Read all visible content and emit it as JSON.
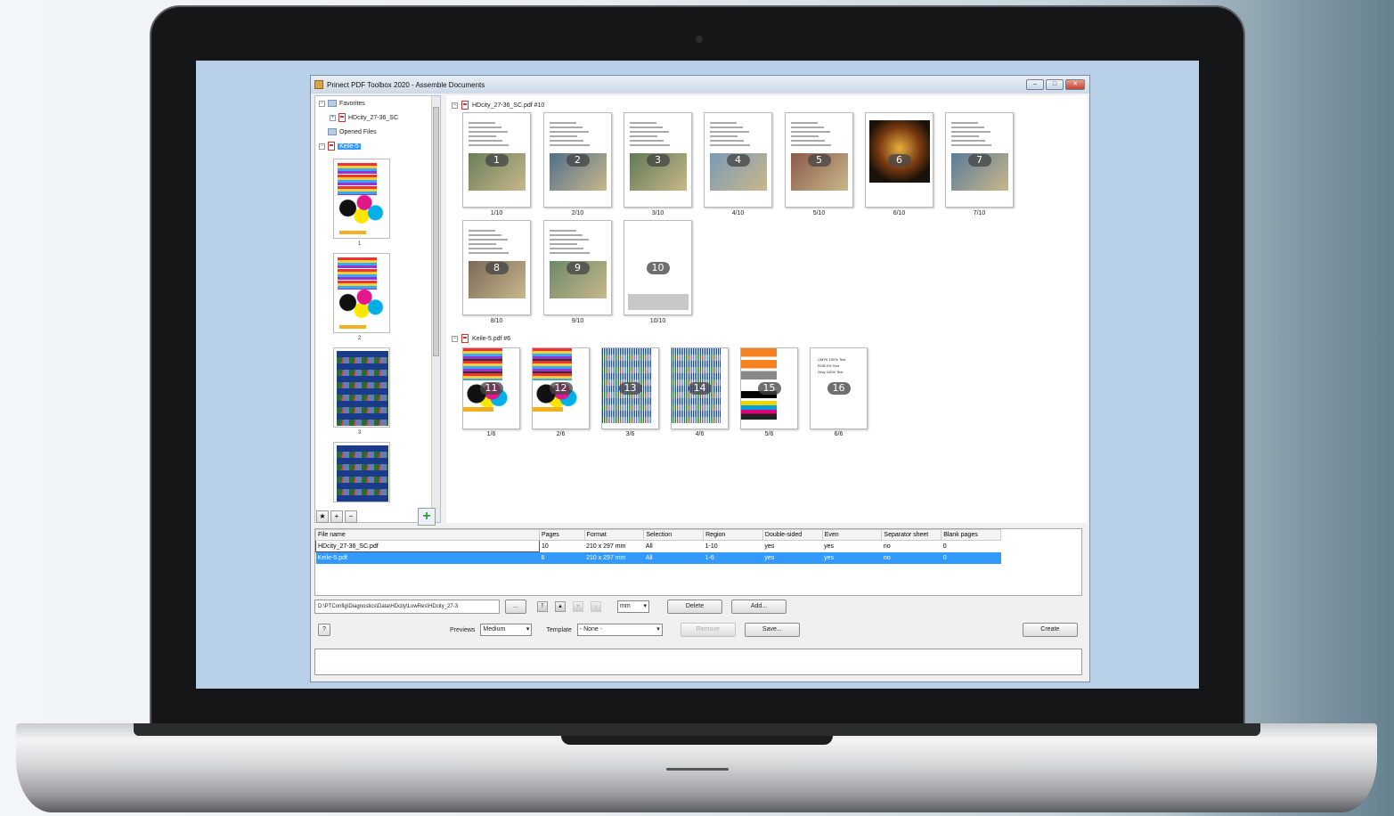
{
  "window": {
    "title": "Prinect PDF Toolbox 2020 - Assemble Documents"
  },
  "tree": {
    "favorites": "Favorites",
    "hdcity_short": "HDcity_27-36_SC",
    "opened_files": "Opened Files",
    "keile": "Keile-5"
  },
  "left_thumbs": [
    "1",
    "2",
    "3"
  ],
  "groups": [
    {
      "title": "HDcity_27-36_SC.pdf  #10"
    },
    {
      "title": "Keile-5.pdf  #6"
    }
  ],
  "pages_hd": [
    {
      "n": "1",
      "label": "1/10"
    },
    {
      "n": "2",
      "label": "2/10"
    },
    {
      "n": "3",
      "label": "3/10"
    },
    {
      "n": "4",
      "label": "4/10"
    },
    {
      "n": "5",
      "label": "5/10"
    },
    {
      "n": "6",
      "label": "6/10"
    },
    {
      "n": "7",
      "label": "7/10"
    },
    {
      "n": "8",
      "label": "8/10"
    },
    {
      "n": "9",
      "label": "9/10"
    },
    {
      "n": "10",
      "label": "10/10"
    }
  ],
  "pages_k": [
    {
      "n": "11",
      "label": "1/6"
    },
    {
      "n": "12",
      "label": "2/6"
    },
    {
      "n": "13",
      "label": "3/6"
    },
    {
      "n": "14",
      "label": "4/6"
    },
    {
      "n": "15",
      "label": "5/6"
    },
    {
      "n": "16",
      "label": "6/6"
    }
  ],
  "page16_text": [
    "CMYK 100% Text",
    "RGB 0% Text",
    "Grey 100% Text"
  ],
  "table": {
    "headers": [
      "File name",
      "Pages",
      "Format",
      "Selection",
      "Region",
      "Double-sided",
      "Even",
      "Separator sheet",
      "Blank pages"
    ],
    "rows": [
      [
        "HDcity_27-36_SC.pdf",
        "10",
        "210 x 297 mm",
        "All",
        "1-10",
        "yes",
        "yes",
        "no",
        "0"
      ],
      [
        "Keile-5.pdf",
        "6",
        "210 x 297 mm",
        "All",
        "1-6",
        "yes",
        "yes",
        "no",
        "0"
      ]
    ]
  },
  "controls": {
    "path": "D:\\PTConfig\\Diagnostics\\Data\\HDcity\\LowRes\\HDcity_27-3",
    "browse": "...",
    "unit": "mm",
    "delete": "Delete",
    "add": "Add...",
    "help": "?",
    "previews_label": "Previews",
    "previews_value": "Medium",
    "template_label": "Template",
    "template_value": "- None -",
    "remove": "Remove",
    "save": "Save...",
    "create": "Create"
  },
  "colors": {
    "selection": "#3399ff",
    "screen": "#b9d0e9"
  }
}
